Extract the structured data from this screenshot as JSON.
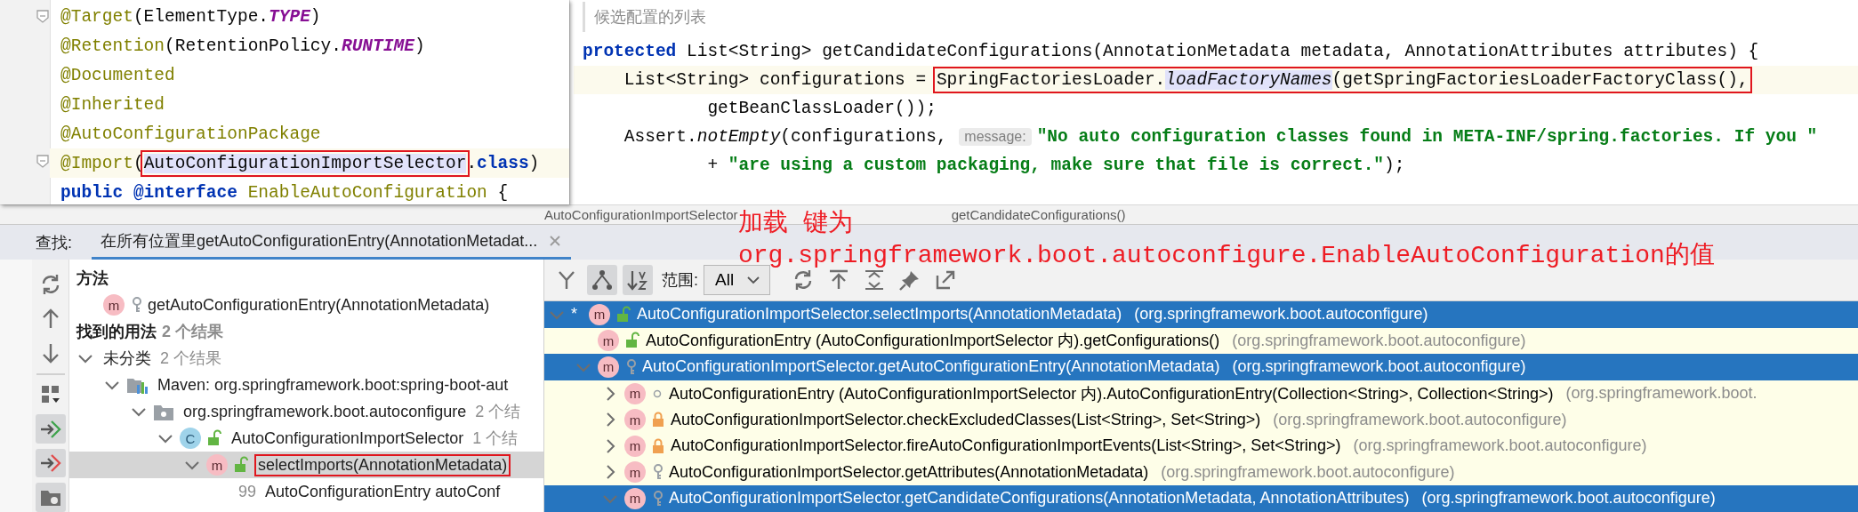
{
  "annotation_popup": {
    "lines": [
      {
        "current": false,
        "fold": true,
        "tokens": [
          {
            "kind": "annotation",
            "text": "@Target"
          },
          {
            "kind": "plain",
            "text": "(ElementType."
          },
          {
            "kind": "constant",
            "text": "TYPE"
          },
          {
            "kind": "plain",
            "text": ")"
          }
        ]
      },
      {
        "current": false,
        "fold": false,
        "tokens": [
          {
            "kind": "annotation",
            "text": "@Retention"
          },
          {
            "kind": "plain",
            "text": "(RetentionPolicy."
          },
          {
            "kind": "constant",
            "text": "RUNTIME"
          },
          {
            "kind": "plain",
            "text": ")"
          }
        ]
      },
      {
        "current": false,
        "fold": false,
        "tokens": [
          {
            "kind": "annotation",
            "text": "@Documented"
          }
        ]
      },
      {
        "current": false,
        "fold": false,
        "tokens": [
          {
            "kind": "annotation",
            "text": "@Inherited"
          }
        ]
      },
      {
        "current": false,
        "fold": false,
        "tokens": [
          {
            "kind": "annotation",
            "text": "@AutoConfigurationPackage"
          }
        ]
      },
      {
        "current": true,
        "fold": true,
        "tokens": [
          {
            "kind": "annotation",
            "text": "@Import"
          },
          {
            "kind": "plain",
            "text": "("
          },
          {
            "kind": "box",
            "tokens": [
              {
                "kind": "highlight",
                "text": "AutoConfigurationImportSelector"
              }
            ]
          },
          {
            "kind": "plain",
            "text": "."
          },
          {
            "kind": "keyword",
            "text": "class"
          },
          {
            "kind": "plain",
            "text": ")"
          }
        ]
      },
      {
        "current": false,
        "fold": false,
        "tokens": [
          {
            "kind": "keyword",
            "text": "public @interface"
          },
          {
            "kind": "annotation",
            "text": " EnableAutoConfiguration"
          },
          {
            "kind": "plain",
            "text": " {"
          }
        ]
      }
    ]
  },
  "editor": {
    "doc_comment": "候选配置的列表",
    "lines": [
      {
        "current": false,
        "tokens": [
          {
            "kind": "keyword",
            "text": "protected"
          },
          {
            "kind": "plain",
            "text": " List<String> getCandidateConfigurations(AnnotationMetadata metadata, AnnotationAttributes attributes) {"
          }
        ]
      },
      {
        "current": true,
        "tokens": [
          {
            "kind": "plain",
            "text": "    List<String> configurations = "
          },
          {
            "kind": "box",
            "tokens": [
              {
                "kind": "plain",
                "text": "SpringFactoriesLoader."
              },
              {
                "kind": "highlight_italic",
                "text": "loadFactoryNames"
              },
              {
                "kind": "plain",
                "text": "(getSpringFactoriesLoaderFactoryClass(),"
              }
            ]
          }
        ]
      },
      {
        "current": false,
        "tokens": [
          {
            "kind": "plain",
            "text": "            getBeanClassLoader());"
          }
        ]
      },
      {
        "current": false,
        "tokens": [
          {
            "kind": "plain",
            "text": "    Assert."
          },
          {
            "kind": "italic",
            "text": "notEmpty"
          },
          {
            "kind": "plain",
            "text": "(configurations, "
          },
          {
            "kind": "hint",
            "text": "message:"
          },
          {
            "kind": "string",
            "text": "\"No auto configuration classes found in META-INF/spring.factories. If you \""
          }
        ]
      },
      {
        "current": false,
        "tokens": [
          {
            "kind": "plain",
            "text": "            + "
          },
          {
            "kind": "string",
            "text": "\"are using a custom packaging, make sure that file is correct.\""
          },
          {
            "kind": "plain",
            "text": ");"
          }
        ]
      }
    ]
  },
  "breadcrumbs": [
    "AutoConfigurationImportSelector",
    "getCandidateConfigurations()"
  ],
  "find_panel": {
    "label": "查找:",
    "tabs": [
      {
        "label": "在所有位置里getAutoConfigurationEntry(AnnotationMetadat...",
        "selected": true
      }
    ],
    "side_toolbar": [
      {
        "kind": "refresh",
        "pressed": false
      },
      {
        "kind": "up",
        "pressed": false
      },
      {
        "kind": "down",
        "pressed": false
      },
      {
        "kind": "group",
        "pressed": false
      },
      {
        "kind": "nav_in",
        "pressed": true
      },
      {
        "kind": "nav_out",
        "pressed": true
      },
      {
        "kind": "folder",
        "pressed": true
      }
    ],
    "usages": {
      "method_heading": "方法",
      "method": {
        "kind": "method",
        "badge": "m",
        "access_icon": {
          "kind": "protected"
        },
        "label": "getAutoConfigurationEntry(AnnotationMetadata)"
      },
      "found_heading": "找到的用法",
      "found_count": "2 个结果",
      "tree": [
        {
          "label": "未分类",
          "count": "2 个结果",
          "expanded": true,
          "selected": false,
          "boxed": false,
          "children": [
            {
              "kind": "module",
              "label": "Maven: org.springframework.boot:spring-boot-aut",
              "expanded": true,
              "selected": false,
              "boxed": false,
              "children": [
                {
                  "kind": "package",
                  "label": "org.springframework.boot.autoconfigure",
                  "count": "2 个结",
                  "expanded": true,
                  "selected": false,
                  "boxed": false,
                  "children": [
                    {
                      "kind": "class",
                      "badge": "C",
                      "access_icon": {
                        "kind": "public"
                      },
                      "label": "AutoConfigurationImportSelector",
                      "count": "1 个结",
                      "expanded": true,
                      "selected": false,
                      "boxed": false,
                      "children": [
                        {
                          "kind": "method",
                          "badge": "m",
                          "access_icon": {
                            "kind": "public"
                          },
                          "label": "selectImports(AnnotationMetadata)",
                          "expanded": true,
                          "selected": true,
                          "boxed": true,
                          "children": [
                            {
                              "kind": "usage",
                              "line": "99",
                              "label": "AutoConfigurationEntry autoConf",
                              "selected": false,
                              "boxed": false
                            }
                          ]
                        }
                      ]
                    }
                  ]
                }
              ]
            }
          ]
        }
      ]
    },
    "hierarchy": {
      "toolbar": [
        {
          "kind": "merge",
          "pressed": false
        },
        {
          "kind": "tree",
          "pressed": true
        },
        {
          "kind": "sort",
          "pressed": true
        }
      ],
      "scope_label": "范围:",
      "scope_value": "All",
      "actions": [
        {
          "kind": "refresh"
        },
        {
          "kind": "export"
        },
        {
          "kind": "expand"
        },
        {
          "kind": "pin"
        },
        {
          "kind": "open"
        }
      ],
      "rows": [
        {
          "prefix": "*",
          "badge": "m",
          "access_icon": {
            "kind": "public"
          },
          "label": "AutoConfigurationImportSelector.selectImports(AnnotationMetadata)",
          "package": "(org.springframework.boot.autoconfigure)",
          "expanded": true,
          "selected": true,
          "children": [
            {
              "badge": "m",
              "access_icon": {
                "kind": "public"
              },
              "label": "AutoConfigurationEntry (AutoConfigurationImportSelector 内).getConfigurations()",
              "package": "(org.springframework.boot.autoconfigure)",
              "selected": false
            },
            {
              "badge": "m",
              "access_icon": {
                "kind": "protected"
              },
              "label": "AutoConfigurationImportSelector.getAutoConfigurationEntry(AnnotationMetadata)",
              "package": "(org.springframework.boot.autoconfigure)",
              "expanded": true,
              "selected": true,
              "children": [
                {
                  "badge": "m",
                  "access_icon": {
                    "kind": "package"
                  },
                  "label": "AutoConfigurationEntry (AutoConfigurationImportSelector 内).AutoConfigurationEntry(Collection<String>, Collection<String>)",
                  "package": "(org.springframework.boot.",
                  "expanded": false,
                  "selected": false
                },
                {
                  "badge": "m",
                  "access_icon": {
                    "kind": "private"
                  },
                  "label": "AutoConfigurationImportSelector.checkExcludedClasses(List<String>, Set<String>)",
                  "package": "(org.springframework.boot.autoconfigure)",
                  "expanded": false,
                  "selected": false
                },
                {
                  "badge": "m",
                  "access_icon": {
                    "kind": "private"
                  },
                  "label": "AutoConfigurationImportSelector.fireAutoConfigurationImportEvents(List<String>, Set<String>)",
                  "package": "(org.springframework.boot.autoconfigure)",
                  "expanded": false,
                  "selected": false
                },
                {
                  "badge": "m",
                  "access_icon": {
                    "kind": "protected"
                  },
                  "label": "AutoConfigurationImportSelector.getAttributes(AnnotationMetadata)",
                  "package": "(org.springframework.boot.autoconfigure)",
                  "expanded": false,
                  "selected": false
                },
                {
                  "badge": "m",
                  "access_icon": {
                    "kind": "protected"
                  },
                  "label": "AutoConfigurationImportSelector.getCandidateConfigurations(AnnotationMetadata, AnnotationAttributes)",
                  "package": "(org.springframework.boot.autoconfigure)",
                  "expanded": true,
                  "selected": true
                }
              ]
            }
          ]
        }
      ]
    }
  },
  "annotation_note": {
    "lines": [
      "加载 键为",
      "org.springframework.boot.autoconfigure.EnableAutoConfiguration的值"
    ]
  }
}
